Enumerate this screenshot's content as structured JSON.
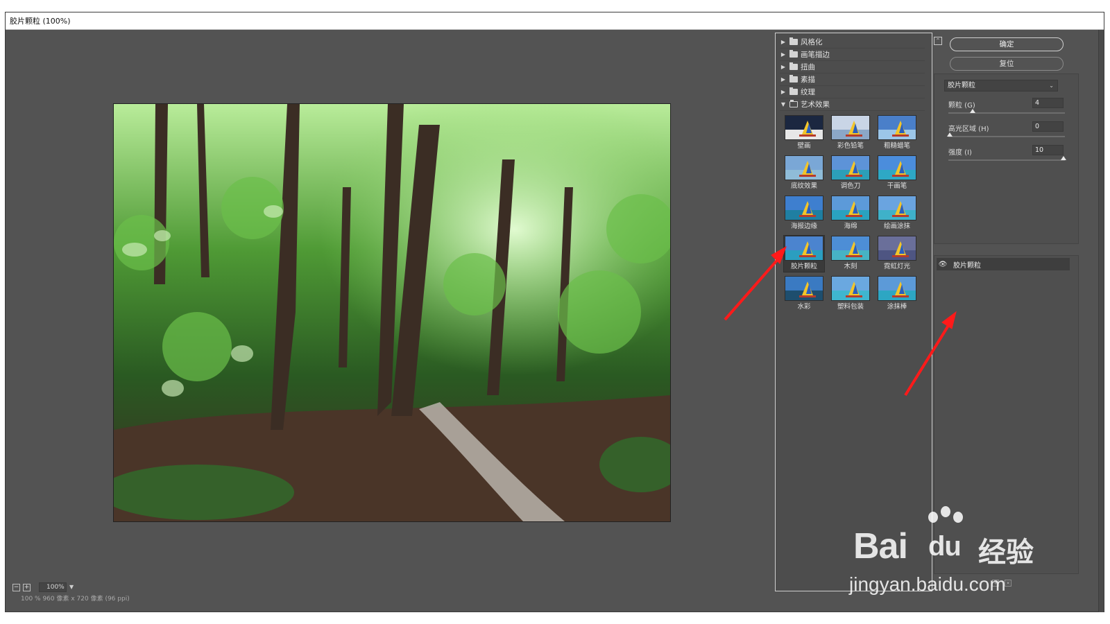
{
  "window": {
    "title": "胶片颗粒 (100%)"
  },
  "preview": {
    "zoom": "100%",
    "status": "100 %    960 像素 x 720 像素 (96 ppi)"
  },
  "gallery": {
    "folders": [
      {
        "label": "风格化",
        "open": false
      },
      {
        "label": "画笔描边",
        "open": false
      },
      {
        "label": "扭曲",
        "open": false
      },
      {
        "label": "素描",
        "open": false
      },
      {
        "label": "纹理",
        "open": false
      },
      {
        "label": "艺术效果",
        "open": true
      }
    ],
    "filters": [
      {
        "label": "壁画",
        "sky": "#1b2740",
        "sea": "#e7e7e7"
      },
      {
        "label": "彩色铅笔",
        "sky": "#c9d5e6",
        "sea": "#8ba7c7"
      },
      {
        "label": "粗糙蜡笔",
        "sky": "#4a7fc9",
        "sea": "#9cc6e8"
      },
      {
        "label": "底纹效果",
        "sky": "#7aa7d6",
        "sea": "#8fbcd8"
      },
      {
        "label": "调色刀",
        "sky": "#5d93d8",
        "sea": "#2c9fb8"
      },
      {
        "label": "干画笔",
        "sky": "#4b8ddc",
        "sea": "#2ea8c5"
      },
      {
        "label": "海报边缘",
        "sky": "#3e7fcf",
        "sea": "#1f7fa2"
      },
      {
        "label": "海绵",
        "sky": "#5c9ad9",
        "sea": "#2aa2bf"
      },
      {
        "label": "绘画涂抹",
        "sky": "#6aa4e0",
        "sea": "#3fb1c9"
      },
      {
        "label": "胶片颗粒",
        "sky": "#4b84cf",
        "sea": "#2b9ec0"
      },
      {
        "label": "木刻",
        "sky": "#4d8ed6",
        "sea": "#47b3c4"
      },
      {
        "label": "霓虹灯光",
        "sky": "#6a6f9a",
        "sea": "#4e5582"
      },
      {
        "label": "水彩",
        "sky": "#3a7ac2",
        "sea": "#1e4e6e"
      },
      {
        "label": "塑料包装",
        "sky": "#6aa8e0",
        "sea": "#3fb6cf"
      },
      {
        "label": "涂抹棒",
        "sky": "#5c9ad8",
        "sea": "#2da6c3"
      }
    ],
    "selected_index": 9
  },
  "controls": {
    "ok_label": "确定",
    "reset_label": "复位",
    "filter_select": "胶片颗粒",
    "params": [
      {
        "label": "颗粒 (G)",
        "value": "4",
        "fraction": 0.2
      },
      {
        "label": "高光区域 (H)",
        "value": "0",
        "fraction": 0.0
      },
      {
        "label": "强度 (I)",
        "value": "10",
        "fraction": 1.0
      }
    ]
  },
  "layers": [
    {
      "name": "胶片颗粒",
      "visible": true
    }
  ],
  "watermark": {
    "logo": "Bai",
    "logo_tail": "du",
    "cn": "经验",
    "url": "jingyan.baidu.com"
  },
  "colors": {
    "annotation_arrow": "#ff1a1a",
    "panel_bg": "#535353"
  }
}
